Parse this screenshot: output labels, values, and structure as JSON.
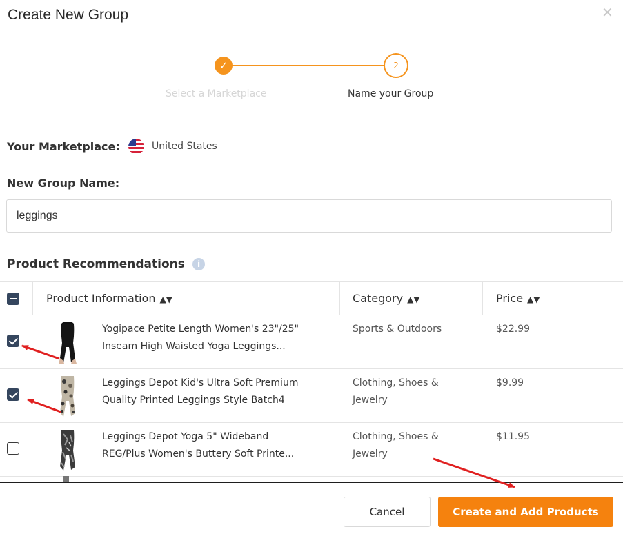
{
  "dialog": {
    "title": "Create New Group",
    "close_icon": "close-icon"
  },
  "stepper": {
    "step1": {
      "label": "Select a Marketplace",
      "state": "completed",
      "icon": "check-icon"
    },
    "step2": {
      "label": "Name your Group",
      "number": "2",
      "state": "active"
    }
  },
  "marketplace": {
    "label": "Your Marketplace:",
    "value": "United States",
    "flag_icon": "us-flag-icon"
  },
  "group_name": {
    "label": "New Group Name:",
    "value": "leggings"
  },
  "recommendations": {
    "label": "Product Recommendations",
    "info_icon": "info-icon",
    "columns": {
      "product": "Product Information",
      "category": "Category",
      "price": "Price"
    },
    "rows": [
      {
        "checked": true,
        "name_line1": "Yogipace Petite Length Women's 23\"/25\"",
        "name_line2": "Inseam High Waisted Yoga Leggings...",
        "category_line1": "Sports & Outdoors",
        "category_line2": "",
        "price": "$22.99"
      },
      {
        "checked": true,
        "name_line1": "Leggings Depot Kid's Ultra Soft Premium",
        "name_line2": "Quality Printed Leggings Style Batch4",
        "category_line1": "Clothing, Shoes &",
        "category_line2": "Jewelry",
        "price": "$9.99"
      },
      {
        "checked": false,
        "name_line1": "Leggings Depot Yoga 5\" Wideband",
        "name_line2": "REG/Plus Women's Buttery Soft Printe...",
        "category_line1": "Clothing, Shoes &",
        "category_line2": "Jewelry",
        "price": "$11.95"
      }
    ]
  },
  "footer": {
    "cancel_label": "Cancel",
    "create_label": "Create and Add Products"
  },
  "colors": {
    "accent": "#f5820e",
    "step": "#f5941e",
    "checkbox": "#35465e",
    "annotation_arrow": "#e02020"
  }
}
